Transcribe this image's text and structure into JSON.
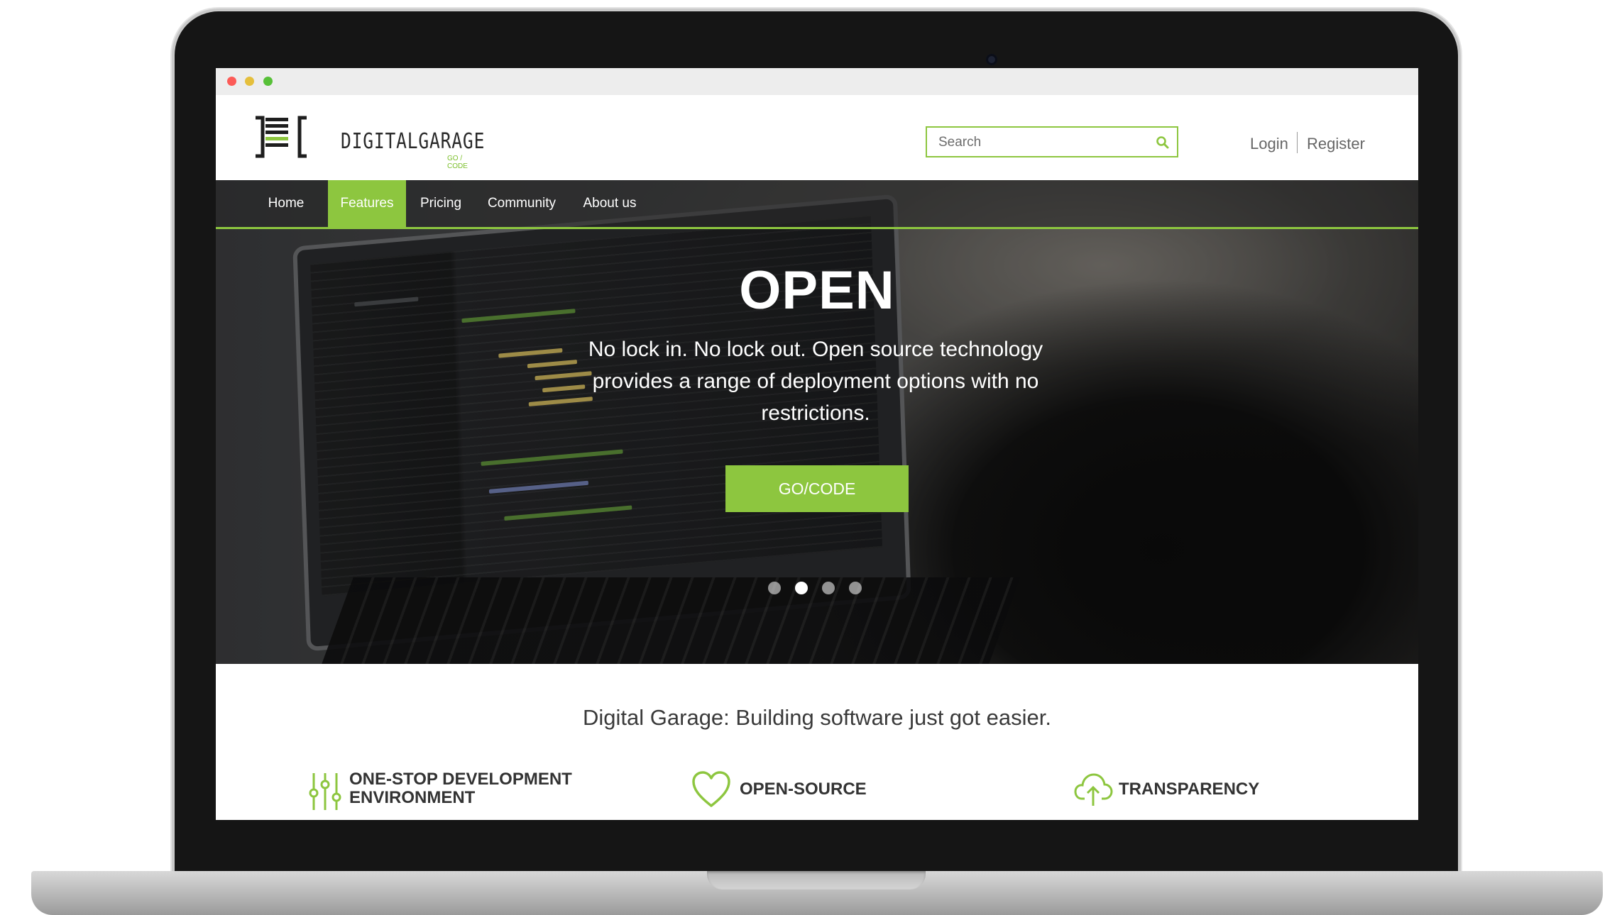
{
  "brand": {
    "name": "DIGITALGARAGE",
    "tagline": "GO / CODE"
  },
  "search": {
    "placeholder": "Search"
  },
  "account": {
    "login": "Login",
    "register": "Register"
  },
  "nav": {
    "items": [
      {
        "label": "Home",
        "active": false
      },
      {
        "label": "Features",
        "active": true
      },
      {
        "label": "Pricing",
        "active": false
      },
      {
        "label": "Community",
        "active": false
      },
      {
        "label": "About us",
        "active": false
      }
    ]
  },
  "hero": {
    "title": "OPEN",
    "text": "No lock in. No lock out. Open source technology provides a range of deployment options with no restrictions.",
    "cta": "GO/CODE",
    "slides": {
      "count": 4,
      "active_index": 1
    }
  },
  "content": {
    "tagline": "Digital Garage: Building software just got easier.",
    "features": [
      {
        "label_line1": "ONE-STOP DEVELOPMENT",
        "label_line2": "ENVIRONMENT",
        "icon": "sliders-icon"
      },
      {
        "label_line1": "OPEN-SOURCE",
        "label_line2": "",
        "icon": "heart-icon"
      },
      {
        "label_line1": "TRANSPARENCY",
        "label_line2": "",
        "icon": "cloud-upload-icon"
      }
    ]
  },
  "colors": {
    "accent": "#8dc63f",
    "nav_text": "#ffffff",
    "body_text": "#3a3a3a"
  }
}
